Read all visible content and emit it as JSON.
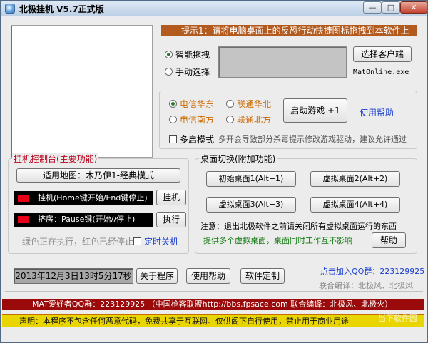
{
  "window": {
    "title": "北极挂机 V5.7正式版",
    "min_label": "—",
    "max_label": "□",
    "close_label": "✕"
  },
  "tip1": "提示1：请将电脑桌面上的反恐行动快捷图标拖拽到本软件上",
  "mode": {
    "smart": "智能拖拽",
    "manual": "手动选择",
    "selected": "smart"
  },
  "select_client_label": "选择客户端",
  "client_exe": "MatOnline.exe",
  "servers": {
    "items": [
      "电信华东",
      "联通华北",
      "电信南方",
      "联通北方"
    ],
    "selected": "电信华东"
  },
  "start_game_label": "启动游戏 +1",
  "help_link": "使用帮助",
  "multi_mode": {
    "label": "多启模式",
    "checked": false,
    "note": "多开会导致部分杀毒提示修改游戏驱动，建议允许通过"
  },
  "console": {
    "legend": "挂机控制台(主要功能)",
    "map_button": "适用地图：木乃伊1-经典模式",
    "hang_status": "挂机(Home键开始/End键停止)",
    "hang_button": "挂机",
    "crowd_status": "挤房：Pause键(开始//停止)",
    "exec_button": "执行",
    "legend_note": "绿色正在执行，红色已经停止",
    "timer_shutdown": "定时关机",
    "lamp_color": "#e80018"
  },
  "desktop": {
    "legend": "桌面切换(附加功能)",
    "buttons": [
      "初始桌面1(Alt+1)",
      "虚拟桌面2(Alt+2)",
      "虚拟桌面3(Alt+3)",
      "虚拟桌面4(Alt+4)"
    ],
    "note": "注意：退出北极软件之前请关闭所有虚拟桌面运行的东西",
    "feature": "提供多个虚拟桌面，桌面同时工作互不影响",
    "help_button": "帮助"
  },
  "datetime": "2013年12月3日13时5分17秒",
  "bottom_buttons": {
    "about": "关于程序",
    "help": "使用帮助",
    "custom": "软件定制"
  },
  "qq_join": "点击加入QQ群：223129925",
  "authors": "联合编译：北极风、北极风",
  "bar_red": "MAT爱好者QQ群：223129925   （中国枪客联盟http://bbs.fpsace.com 联合编译：北极风、北极火）",
  "bar_yellow": "声明：本程序不包含任何恶意代码，免费共享于互联网。仅供阁下自行使用，禁止用于商业用途",
  "watermark": "当下软件园"
}
